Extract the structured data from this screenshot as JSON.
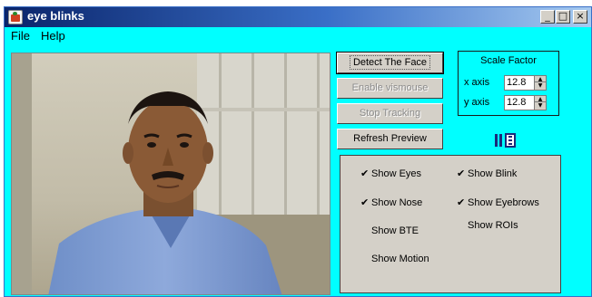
{
  "window": {
    "title": "eye blinks",
    "minimize_glyph": "_",
    "maximize_glyph": "□",
    "close_glyph": "×"
  },
  "menu": {
    "items": [
      {
        "label": "File"
      },
      {
        "label": "Help"
      }
    ]
  },
  "controls": {
    "buttons": [
      {
        "label": "Detect The Face",
        "enabled": true,
        "focused": true
      },
      {
        "label": "Enable vismouse",
        "enabled": false
      },
      {
        "label": "Stop Tracking",
        "enabled": false
      },
      {
        "label": "Refresh Preview",
        "enabled": true
      }
    ]
  },
  "scale_factor": {
    "title": "Scale Factor",
    "x_label": "x axis",
    "x_value": "12.8",
    "y_label": "y axis",
    "y_value": "12.8"
  },
  "toolbar": {
    "icons": [
      "pause-icon",
      "film-icon"
    ]
  },
  "options": {
    "items": [
      {
        "label": "Show Eyes",
        "checked": true
      },
      {
        "label": "Show Blink",
        "checked": true
      },
      {
        "label": "Show Nose",
        "checked": true
      },
      {
        "label": "Show Eyebrows",
        "checked": true
      },
      {
        "label": "Show BTE",
        "checked": false
      },
      {
        "label": "Show ROIs",
        "checked": false
      },
      {
        "label": "Show Motion",
        "checked": false
      }
    ],
    "check_glyph": "✔"
  },
  "colors": {
    "background": "#00ffff",
    "title_bar": "#0a246a",
    "panel": "#d4d0c8",
    "disabled_text": "#8a8a8a"
  }
}
